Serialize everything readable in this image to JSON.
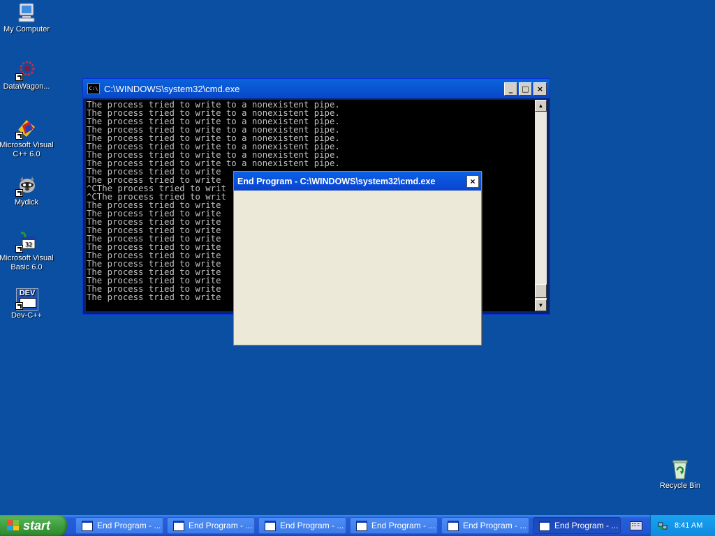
{
  "desktop": {
    "icons": [
      {
        "label_1": "My Computer",
        "label_2": "",
        "icon": "my-computer-icon"
      },
      {
        "label_1": "DataWagon...",
        "label_2": "",
        "icon": "datawagon-icon"
      },
      {
        "label_1": "Microsoft Visual",
        "label_2": "C++ 6.0",
        "icon": "visual-cpp-icon"
      },
      {
        "label_1": "Mydick",
        "label_2": "",
        "icon": "raccoon-icon"
      },
      {
        "label_1": "Microsoft Visual",
        "label_2": "Basic 6.0",
        "icon": "visual-basic-icon"
      },
      {
        "label_1": "Dev-C++",
        "label_2": "",
        "icon": "dev-cpp-icon",
        "badge": "DEV"
      }
    ],
    "recycle_bin": {
      "label": "Recycle Bin",
      "icon": "recycle-bin-icon"
    }
  },
  "cmd_window": {
    "title": "C:\\WINDOWS\\system32\\cmd.exe",
    "sys_icon_text": "C:\\",
    "minimize": "_",
    "maximize": "□",
    "close": "×",
    "lines": [
      "The process tried to write to a nonexistent pipe.",
      "The process tried to write to a nonexistent pipe.",
      "The process tried to write to a nonexistent pipe.",
      "The process tried to write to a nonexistent pipe.",
      "The process tried to write to a nonexistent pipe.",
      "The process tried to write to a nonexistent pipe.",
      "The process tried to write to a nonexistent pipe.",
      "The process tried to write to a nonexistent pipe.",
      "The process tried to write",
      "The process tried to write",
      "^CThe process tried to writ",
      "^CThe process tried to writ",
      "The process tried to write",
      "The process tried to write",
      "The process tried to write",
      "The process tried to write",
      "The process tried to write",
      "The process tried to write",
      "The process tried to write",
      "The process tried to write",
      "The process tried to write",
      "The process tried to write",
      "The process tried to write",
      "The process tried to write"
    ]
  },
  "end_dialog": {
    "title": "End Program - C:\\WINDOWS\\system32\\cmd.exe",
    "close": "×"
  },
  "taskbar": {
    "start_label": "start",
    "buttons": [
      {
        "label": "End Program - ...",
        "active": false
      },
      {
        "label": "End Program - ...",
        "active": false
      },
      {
        "label": "End Program - ...",
        "active": false
      },
      {
        "label": "End Program - ...",
        "active": false
      },
      {
        "label": "End Program - ...",
        "active": false
      },
      {
        "label": "End Program - ...",
        "active": true
      }
    ],
    "clock": "8:41 AM"
  },
  "colors": {
    "desktop_bg": "#0b4fa2",
    "console_bg": "#000000",
    "console_text": "#c0c0c0",
    "title_blue": "#0a5ce0",
    "dialog_bg": "#ece9d8",
    "start_green": "#3b9b3b"
  }
}
